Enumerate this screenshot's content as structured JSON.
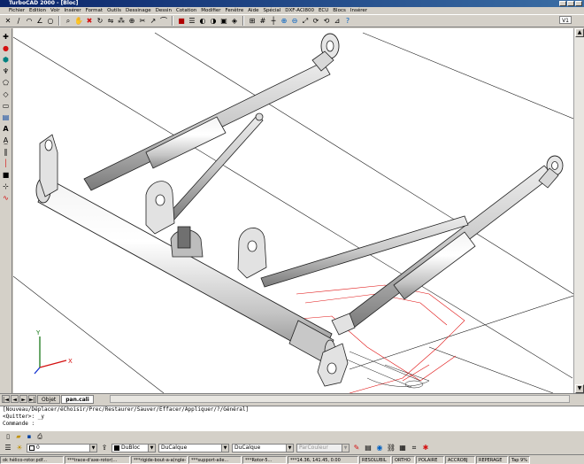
{
  "window": {
    "title": "TurboCAD 2000 - [Bloc]"
  },
  "menu": [
    "Fichier",
    "Edition",
    "Voir",
    "Insérer",
    "Format",
    "Outils",
    "Dessinage",
    "Dessin",
    "Cotation",
    "Modifier",
    "Fenêtre",
    "Aide",
    "Spécial",
    "DXF-ACI800",
    "ECU",
    "Blocs",
    "Insérer"
  ],
  "toolbar_top": {
    "icons": [
      "select-icon",
      "line-icon",
      "arc-icon",
      "polyline-icon",
      "circle-icon",
      "zoom-icon",
      "pan-icon",
      "cross-icon",
      "rotate-icon",
      "mirror-icon",
      "array-icon",
      "offset-icon",
      "trim-icon",
      "extend-icon",
      "fillet-icon",
      "layer-icon",
      "properties-icon",
      "render-icon",
      "shade-icon",
      "hide-icon",
      "view-3d-icon",
      "snap-icon",
      "grid-icon",
      "ortho-icon",
      "zoom-in-icon",
      "zoom-out-icon",
      "zoom-all-icon",
      "regen-icon",
      "redraw-icon",
      "measure-icon",
      "help-icon"
    ],
    "view_label": "V1"
  },
  "toolbar_left": {
    "icons": [
      "pointer-icon",
      "circle-red-icon",
      "hexagon-icon",
      "insert-icon",
      "polygon-icon",
      "point-icon",
      "rectangle-icon",
      "hatch-icon",
      "text-icon",
      "dimension-icon",
      "measure-icon",
      "line-icon",
      "color-black-icon",
      "ucs-icon",
      "curve-icon"
    ]
  },
  "drawing": {
    "ucs_axis_x": "X",
    "ucs_axis_y": "Y"
  },
  "tabs": {
    "nav": [
      "|◄",
      "◄",
      "►",
      "►|"
    ],
    "items": [
      "Objet",
      "pan.cali"
    ],
    "active": "pan.cali"
  },
  "command": {
    "lines": [
      "[Nouveau/Déplacer/éChoisir/Prec/Restaurer/Sauver/Effacer/Appliquer/?/Général]",
      "<Quitter>: _y"
    ],
    "prompt": "Commande :"
  },
  "toolbar_bottom": {
    "icons": [
      "new-icon",
      "open-icon",
      "save-icon",
      "print-icon"
    ]
  },
  "properties": {
    "layer": "0",
    "color": "DuBloc",
    "linetype": "DuCalque",
    "lineweight": "DuCalque",
    "plotstyle": "ParCouleur"
  },
  "status": [
    "ok hélico-rotor.pdf...",
    "***trace-d'axe-rotor(...",
    "***rigide-bout-a-a(ngle-1)...",
    "***support-aile...",
    "***Rotor-5...",
    "***14.36, 141.45, 0.00",
    "RESOLUBIL",
    "ORTHO",
    "POLAIRE",
    "ACCROBJ",
    "REPERAGE",
    "Tap 9%"
  ],
  "colors": {
    "titlebar": "#0a246a",
    "background": "#d4d0c8",
    "viewport": "#ffffff",
    "accent-red": "#d41010"
  }
}
